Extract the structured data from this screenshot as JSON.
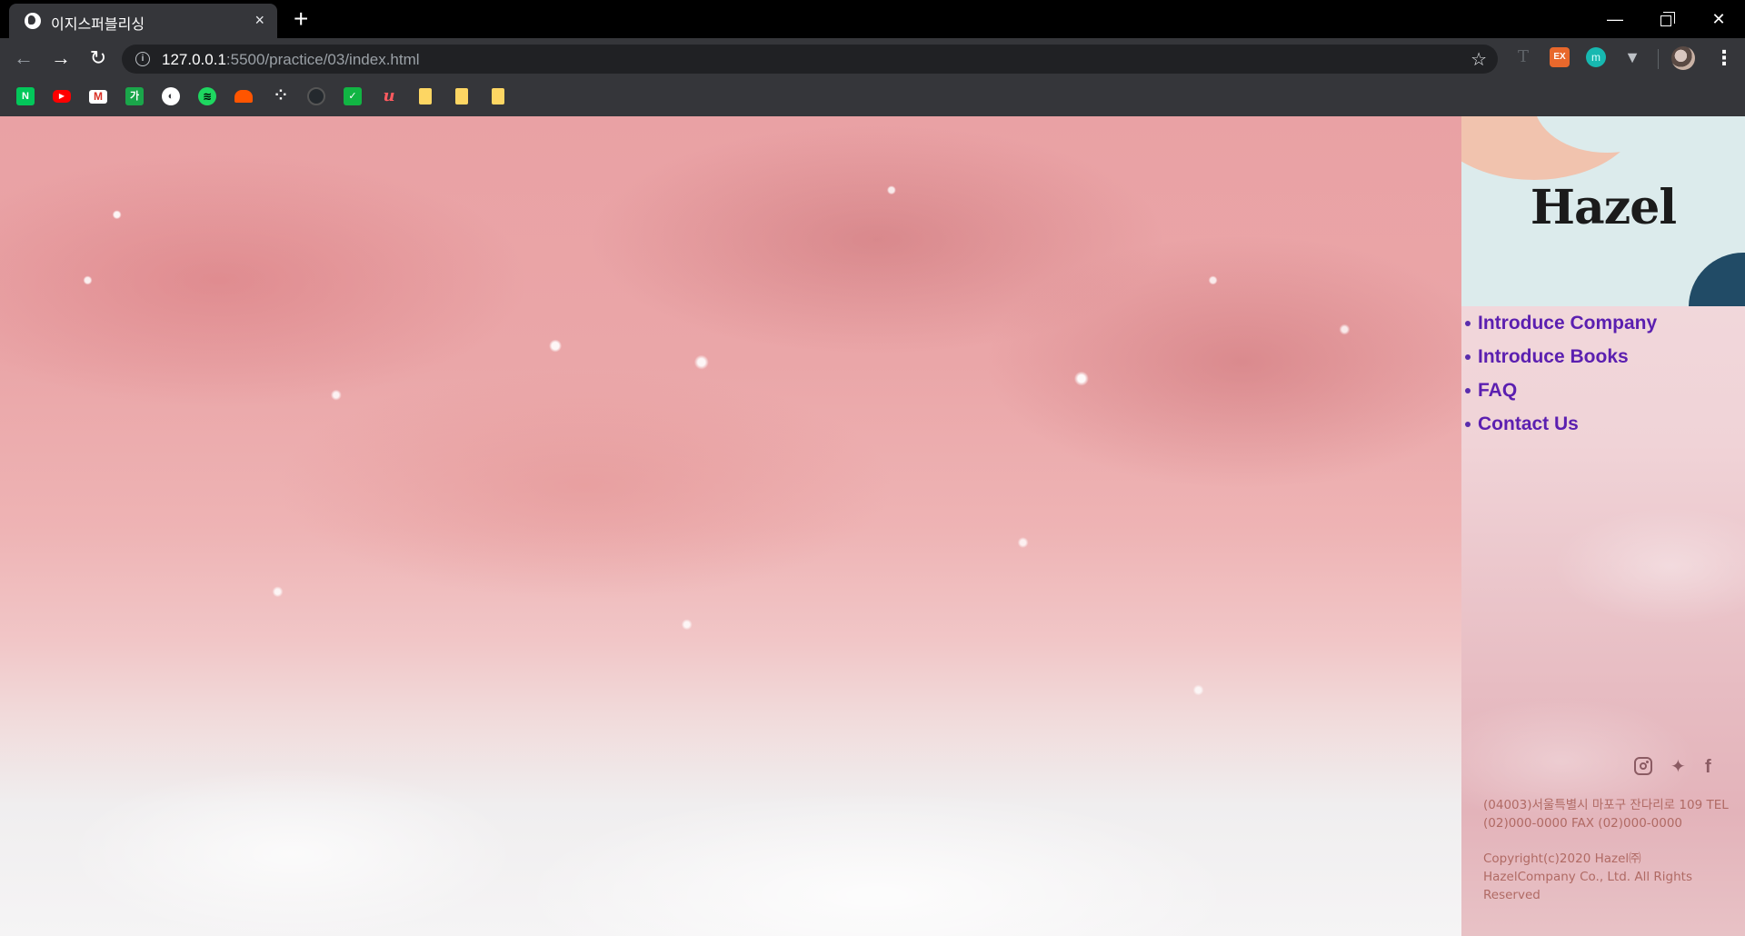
{
  "browser": {
    "tab_title": "이지스퍼블리싱",
    "tab_close": "×",
    "new_tab": "+",
    "url_host": "127.0.0.1",
    "url_path": ":5500/practice/03/index.html",
    "window_controls": {
      "minimize": "—",
      "close": "✕"
    },
    "extensions": [
      "T",
      "EX",
      "m",
      "V"
    ],
    "bookmarks": [
      "N",
      "▶",
      "M",
      "가",
      "globe",
      "spotify",
      "soundcloud",
      "tidal",
      "github",
      "green-app",
      "u",
      "note",
      "note",
      "note"
    ]
  },
  "site": {
    "logo": "Hazel",
    "nav": [
      {
        "label": "Introduce Company"
      },
      {
        "label": "Introduce Books"
      },
      {
        "label": "FAQ"
      },
      {
        "label": "Contact Us"
      }
    ],
    "sns": {
      "facebook": "f",
      "twitter": "🐦"
    },
    "footer": {
      "address": "(04003)서울특별시 마포구 잔다리로 109 TEL (02)000-0000 FAX (02)000-0000",
      "copyright": "Copyright(c)2020 Hazel㈜ HazelCompany Co., Ltd. All Rights Reserved"
    }
  },
  "colors": {
    "nav_link": "#5b1fb0",
    "footer_text": "#b06a64",
    "chrome_dark": "#35363a"
  }
}
